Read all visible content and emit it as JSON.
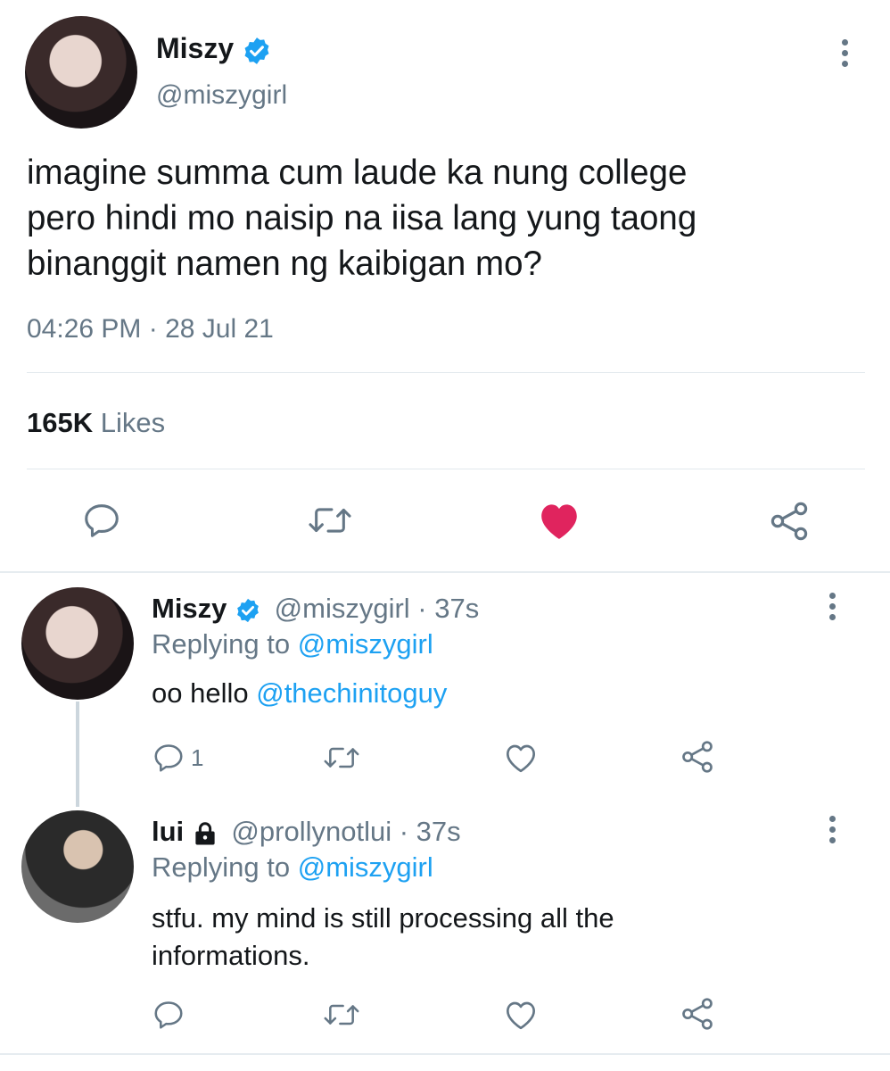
{
  "main_tweet": {
    "display_name": "Miszy",
    "handle": "@miszygirl",
    "text_lines": [
      "imagine summa cum laude ka nung college",
      "pero hindi mo naisip na iisa lang yung taong",
      "binanggit namen ng kaibigan mo?"
    ],
    "timestamp": "04:26 PM · 28 Jul 21",
    "likes_count": "165K",
    "likes_label": "Likes"
  },
  "replies": [
    {
      "display_name": "Miszy",
      "handle": "@miszygirl · 37s",
      "replying_prefix": "Replying to",
      "replying_to": "@miszygirl",
      "text": "oo hello",
      "mention": "@thechinitoguy",
      "reply_count": "1"
    },
    {
      "display_name": "lui",
      "handle": "@prollynotlui · 37s",
      "replying_prefix": "Replying to",
      "replying_to": "@miszygirl",
      "text_lines": [
        "stfu. my mind is still processing all the",
        "informations."
      ]
    }
  ],
  "icons": [
    "verified-badge-icon",
    "more-icon",
    "reply-icon",
    "retweet-icon",
    "like-icon",
    "share-icon",
    "lock-icon"
  ],
  "colors": {
    "accent": "#1da1f2",
    "like": "#e0245e",
    "muted": "#657786",
    "text": "#14171a"
  }
}
